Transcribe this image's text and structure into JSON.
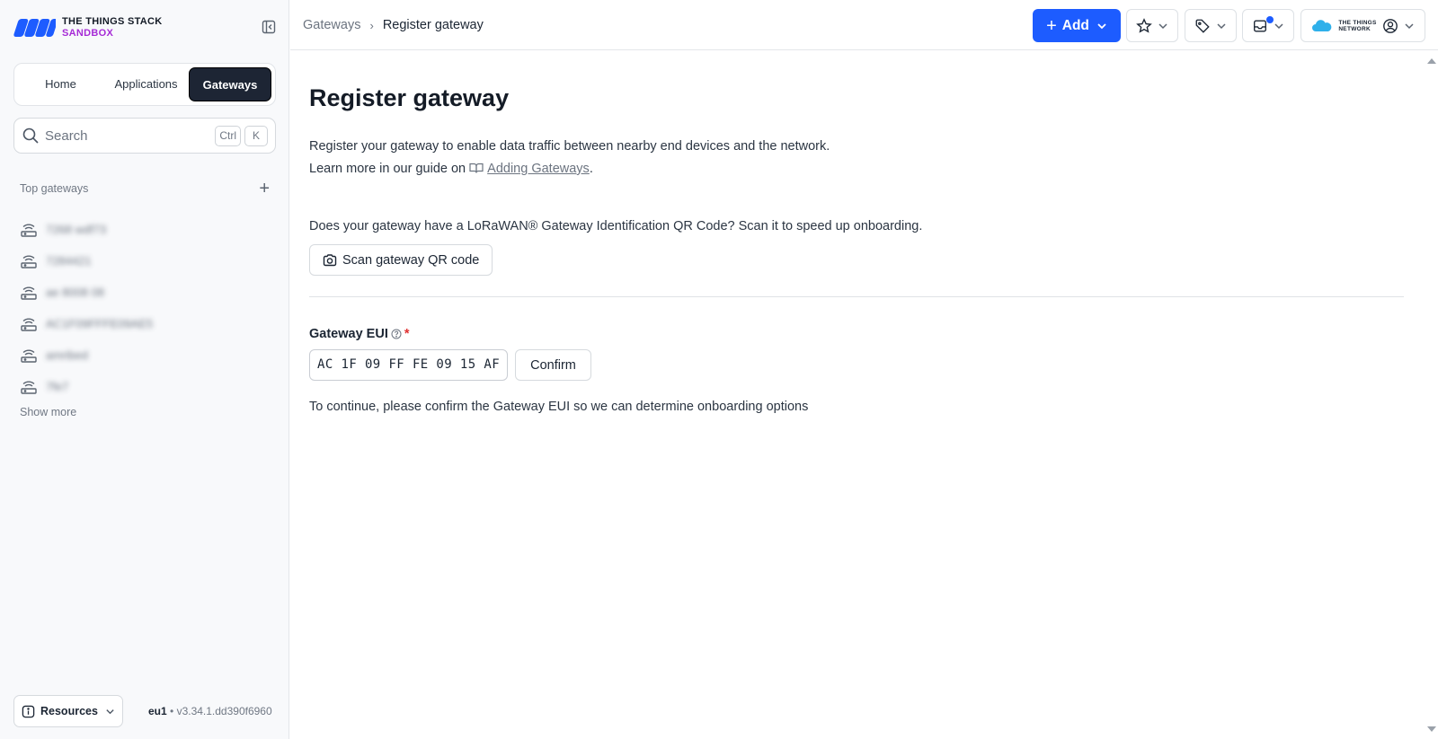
{
  "brand": {
    "line1": "THE THINGS STACK",
    "line2": "SANDBOX"
  },
  "nav": {
    "tabs": [
      "Home",
      "Applications",
      "Gateways"
    ],
    "active": "Gateways"
  },
  "search": {
    "placeholder": "Search",
    "shortcut": [
      "Ctrl",
      "K"
    ]
  },
  "top_gateways": {
    "heading": "Top gateways",
    "items": [
      "7268 wdf73",
      "7284421",
      "ae 8008 08",
      "AC1F09FFFE09AE5",
      "amribed",
      "7fe7"
    ],
    "show_more": "Show more"
  },
  "footer": {
    "resources": "Resources",
    "cluster": "eu1",
    "version": "v3.34.1.dd390f6960"
  },
  "header": {
    "breadcrumb": [
      "Gateways",
      "Register gateway"
    ],
    "add_label": "Add",
    "network_logo": {
      "line1": "THE THINGS",
      "line2": "NETWORK"
    },
    "accent": "#1d5cff"
  },
  "main": {
    "title": "Register gateway",
    "desc_line1": "Register your gateway to enable data traffic between nearby end devices and the network.",
    "desc_line2_prefix": "Learn more in our guide on",
    "guide_link": "Adding Gateways",
    "qr_question": "Does your gateway have a LoRaWAN® Gateway Identification QR Code? Scan it to speed up onboarding.",
    "scan_label": "Scan gateway QR code",
    "eui_label": "Gateway EUI",
    "eui_required": "*",
    "eui_value": "AC 1F 09 FF FE 09 15 AF",
    "confirm_label": "Confirm",
    "hint": "To continue, please confirm the Gateway EUI so we can determine onboarding options"
  },
  "icons": {
    "collapse": "sidebar-collapse-icon",
    "search": "search-icon",
    "gateway": "gateway-icon",
    "info": "info-icon",
    "star": "star-icon",
    "tag": "tag-icon",
    "notifications": "inbox-icon",
    "user": "user-circle-icon",
    "camera": "camera-icon",
    "book": "book-icon",
    "help": "help-icon"
  }
}
